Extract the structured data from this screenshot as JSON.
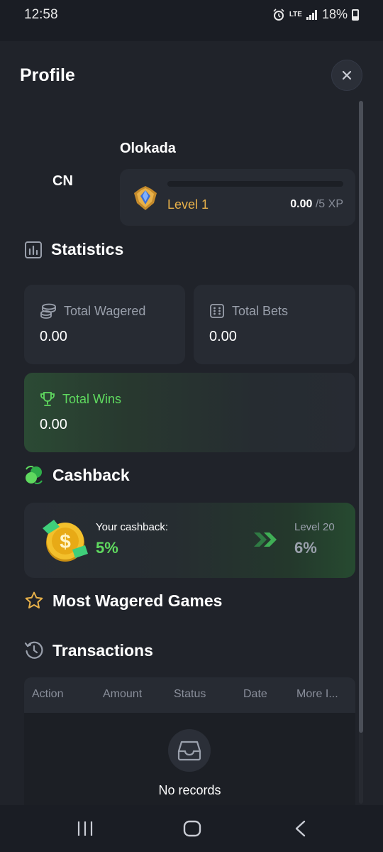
{
  "status_bar": {
    "time": "12:58",
    "network": "LTE",
    "battery": "18%"
  },
  "header": {
    "title": "Profile",
    "close_icon": "close-icon"
  },
  "profile": {
    "username": "Olokada",
    "avatar_text": "CN",
    "level_label": "Level 1",
    "xp_current": "0.00",
    "xp_total": "/5 XP",
    "xp_progress_percent": 0
  },
  "statistics": {
    "title": "Statistics",
    "total_wagered_label": "Total Wagered",
    "total_wagered_value": "0.00",
    "total_bets_label": "Total Bets",
    "total_bets_value": "0.00",
    "total_wins_label": "Total Wins",
    "total_wins_value": "0.00"
  },
  "cashback": {
    "title": "Cashback",
    "your_label": "Your cashback:",
    "your_value": "5%",
    "next_level_label": "Level 20",
    "next_level_value": "6%"
  },
  "most_wagered": {
    "title": "Most Wagered Games"
  },
  "transactions": {
    "title": "Transactions",
    "columns": [
      "Action",
      "Amount",
      "Status",
      "Date",
      "More I..."
    ],
    "empty_text": "No records"
  },
  "colors": {
    "panel": "#20232a",
    "card": "#272b33",
    "accent_green": "#5fd95f",
    "accent_gold": "#e8b14a"
  }
}
